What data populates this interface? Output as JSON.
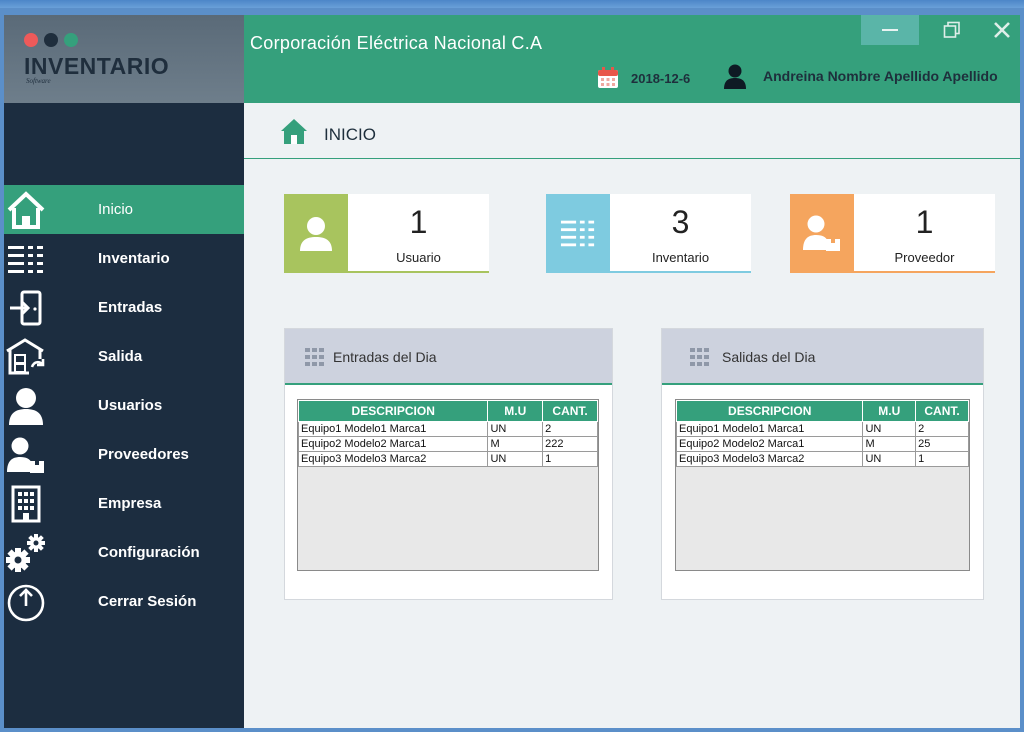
{
  "app": {
    "logo_title": "INVENTARIO",
    "logo_sub": "Software",
    "dot_colors": [
      "#ee5a5a",
      "#1f2e3d",
      "#35a07c"
    ]
  },
  "header": {
    "company": "Corporación Eléctrica Nacional C.A",
    "date": "2018-12-6",
    "user": "Andreina Nombre Apellido Apellido"
  },
  "sidebar": {
    "items": [
      {
        "label": "Inicio",
        "icon": "home-icon",
        "active": true
      },
      {
        "label": "Inventario",
        "icon": "list-icon"
      },
      {
        "label": "Entradas",
        "icon": "entry-door-icon"
      },
      {
        "label": "Salida",
        "icon": "warehouse-exit-icon"
      },
      {
        "label": "Usuarios",
        "icon": "user-icon"
      },
      {
        "label": "Proveedores",
        "icon": "supplier-icon"
      },
      {
        "label": "Empresa",
        "icon": "building-icon"
      },
      {
        "label": "Configuración",
        "icon": "gears-icon"
      },
      {
        "label": "Cerrar Sesión",
        "icon": "power-icon"
      }
    ]
  },
  "page": {
    "title": "INICIO"
  },
  "cards": [
    {
      "value": "1",
      "label": "Usuario",
      "color": "#a8c45e"
    },
    {
      "value": "3",
      "label": "Inventario",
      "color": "#7ecbe0"
    },
    {
      "value": "1",
      "label": "Proveedor",
      "color": "#f5a55e"
    }
  ],
  "entradas": {
    "title": "Entradas del Dia",
    "headers": [
      "DESCRIPCION",
      "M.U",
      "CANT."
    ],
    "rows": [
      [
        "Equipo1  Modelo1  Marca1",
        "UN",
        "2"
      ],
      [
        "Equipo2  Modelo2  Marca1",
        "M",
        "222"
      ],
      [
        "Equipo3  Modelo3  Marca2",
        "UN",
        "1"
      ]
    ]
  },
  "salidas": {
    "title": "Salidas del Dia",
    "headers": [
      "DESCRIPCION",
      "M.U",
      "CANT."
    ],
    "rows": [
      [
        "Equipo1  Modelo1  Marca1",
        "UN",
        "2"
      ],
      [
        "Equipo2  Modelo2  Marca1",
        "M",
        "25"
      ],
      [
        "Equipo3  Modelo3  Marca2",
        "UN",
        "1"
      ]
    ]
  },
  "colors": {
    "accent": "#35a07c",
    "sidebar": "#1c2d40"
  }
}
